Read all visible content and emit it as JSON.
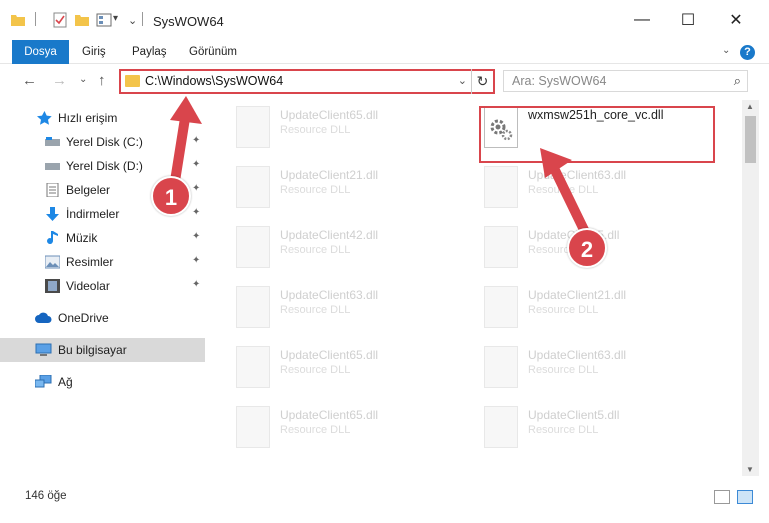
{
  "window": {
    "title": "SysWOW64",
    "min_glyph": "—",
    "max_glyph": "☐",
    "close_glyph": "✕",
    "qa_glyph": "⌄"
  },
  "ribbon": {
    "tabs": [
      "Dosya",
      "Giriş",
      "Paylaş",
      "Görünüm"
    ],
    "help": "?"
  },
  "nav": {
    "back": "←",
    "forward": "→",
    "recent": "⌄",
    "up": "↑",
    "address": "C:\\Windows\\SysWOW64",
    "dropdown": "⌄",
    "refresh": "↻",
    "search_placeholder": "Ara: SysWOW64",
    "search_icon": "⌕"
  },
  "sidebar": {
    "items": [
      {
        "label": "Hızlı erişim",
        "icon": "star-icon",
        "pinned": false
      },
      {
        "label": "Yerel Disk (C:)",
        "icon": "drive-icon",
        "pinned": true
      },
      {
        "label": "Yerel Disk (D:)",
        "icon": "drive-icon",
        "pinned": true
      },
      {
        "label": "Belgeler",
        "icon": "documents-icon",
        "pinned": true
      },
      {
        "label": "İndirmeler",
        "icon": "download-icon",
        "pinned": true
      },
      {
        "label": "Müzik",
        "icon": "music-icon",
        "pinned": true
      },
      {
        "label": "Resimler",
        "icon": "pictures-icon",
        "pinned": true
      },
      {
        "label": "Videolar",
        "icon": "videos-icon",
        "pinned": true
      },
      {
        "label": "OneDrive",
        "icon": "cloud-icon",
        "pinned": false
      },
      {
        "label": "Bu bilgisayar",
        "icon": "computer-icon",
        "pinned": false,
        "selected": true
      },
      {
        "label": "Ağ",
        "icon": "network-icon",
        "pinned": false
      }
    ],
    "pin_glyph": "📌"
  },
  "files": {
    "left": [
      {
        "name": "UpdateClient65.dll",
        "type": "Resource DLL"
      },
      {
        "name": "UpdateClient21.dll",
        "type": "Resource DLL"
      },
      {
        "name": "UpdateClient42.dll",
        "type": "Resource DLL"
      },
      {
        "name": "UpdateClient63.dll",
        "type": "Resource DLL"
      },
      {
        "name": "UpdateClient65.dll",
        "type": "Resource DLL"
      },
      {
        "name": "UpdateClient65.dll",
        "type": "Resource DLL"
      }
    ],
    "right": [
      {
        "name": "wxmsw251h_core_vc.dll",
        "type": ""
      },
      {
        "name": "UpdateClient63.dll",
        "type": "Resource DLL"
      },
      {
        "name": "UpdateClient5.dll",
        "type": "Resource DLL"
      },
      {
        "name": "UpdateClient21.dll",
        "type": "Resource DLL"
      },
      {
        "name": "UpdateClient63.dll",
        "type": "Resource DLL"
      },
      {
        "name": "UpdateClient5.dll",
        "type": "Resource DLL"
      }
    ]
  },
  "status": {
    "count": "146 öğe"
  },
  "annotations": {
    "step1": "1",
    "step2": "2"
  },
  "colors": {
    "accent": "#1979ca",
    "highlight": "#d9454c",
    "folder": "#f3c44a"
  }
}
